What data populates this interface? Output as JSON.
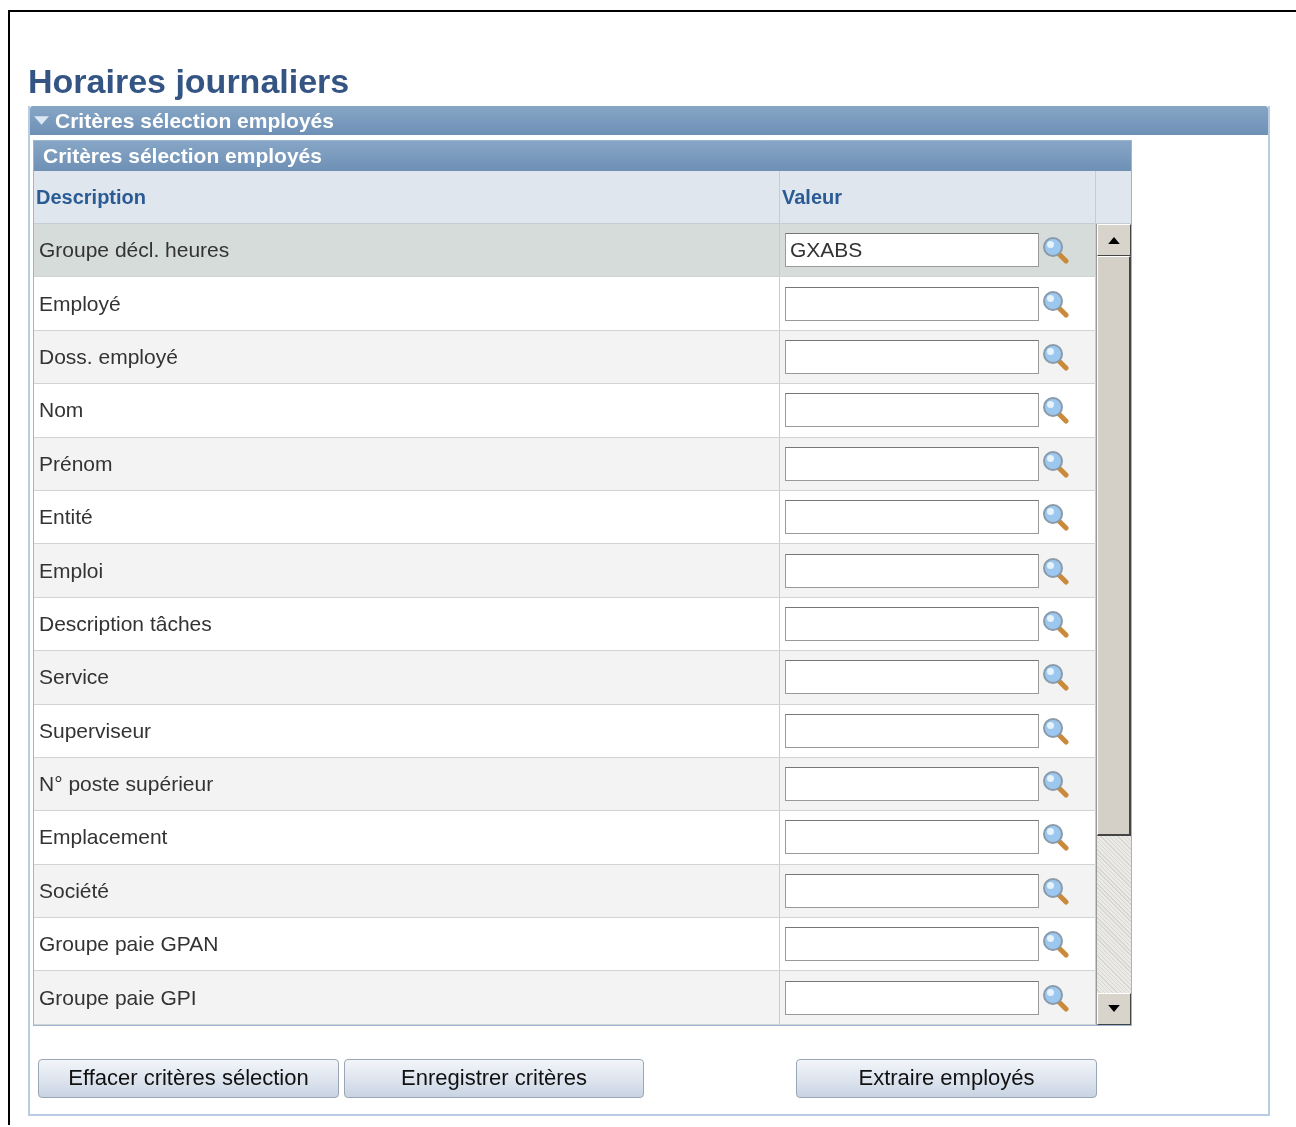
{
  "page": {
    "title": "Horaires journaliers"
  },
  "section": {
    "title": "Critères sélection employés",
    "expanded": true
  },
  "grid": {
    "title": "Critères sélection employés",
    "columns": [
      "Description",
      "Valeur"
    ],
    "rows": [
      {
        "description": "Groupe décl. heures",
        "value": "GXABS",
        "selected": true
      },
      {
        "description": "Employé",
        "value": "",
        "selected": false
      },
      {
        "description": "Doss. employé",
        "value": "",
        "selected": false
      },
      {
        "description": "Nom",
        "value": "",
        "selected": false
      },
      {
        "description": "Prénom",
        "value": "",
        "selected": false
      },
      {
        "description": "Entité",
        "value": "",
        "selected": false
      },
      {
        "description": "Emploi",
        "value": "",
        "selected": false
      },
      {
        "description": "Description tâches",
        "value": "",
        "selected": false
      },
      {
        "description": "Service",
        "value": "",
        "selected": false
      },
      {
        "description": "Superviseur",
        "value": "",
        "selected": false
      },
      {
        "description": "N° poste supérieur",
        "value": "",
        "selected": false
      },
      {
        "description": "Emplacement",
        "value": "",
        "selected": false
      },
      {
        "description": "Société",
        "value": "",
        "selected": false
      },
      {
        "description": "Groupe paie GPAN",
        "value": "",
        "selected": false
      },
      {
        "description": "Groupe paie GPI",
        "value": "",
        "selected": false
      }
    ]
  },
  "buttons": [
    "Effacer critères sélection",
    "Enregistrer critères",
    "Extraire employés"
  ]
}
